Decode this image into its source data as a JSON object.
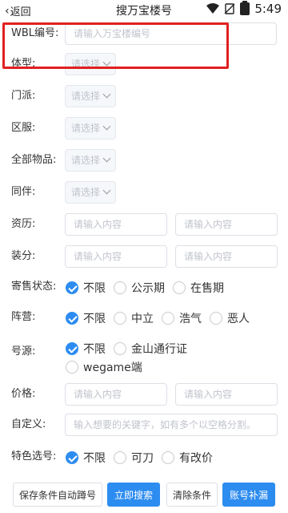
{
  "status": {
    "back_label": "返回",
    "title": "搜万宝楼号",
    "time": "5:49"
  },
  "form": {
    "wbl": {
      "label": "WBL编号:",
      "placeholder": "请输入万宝楼编号"
    },
    "body_type": {
      "label": "体型:",
      "value": "请选择"
    },
    "school": {
      "label": "门派:",
      "value": "请选择"
    },
    "server": {
      "label": "区服:",
      "value": "请选择"
    },
    "items": {
      "label": "全部物品:",
      "value": "请选择"
    },
    "companion": {
      "label": "同伴:",
      "value": "请选择"
    },
    "qualification": {
      "label": "资历:",
      "min_placeholder": "请输入内容",
      "max_placeholder": "请输入内容"
    },
    "gear_score": {
      "label": "装分:",
      "min_placeholder": "请输入内容",
      "max_placeholder": "请输入内容"
    },
    "sale_status": {
      "label": "寄售状态:",
      "options": [
        {
          "label": "不限",
          "checked": true
        },
        {
          "label": "公示期",
          "checked": false
        },
        {
          "label": "在售期",
          "checked": false
        }
      ]
    },
    "camp": {
      "label": "阵营:",
      "options": [
        {
          "label": "不限",
          "checked": true
        },
        {
          "label": "中立",
          "checked": false
        },
        {
          "label": "浩气",
          "checked": false
        },
        {
          "label": "恶人",
          "checked": false
        }
      ]
    },
    "account_source": {
      "label": "号源:",
      "options": [
        {
          "label": "不限",
          "checked": true
        },
        {
          "label": "金山通行证",
          "checked": false
        },
        {
          "label": "wegame端",
          "checked": false
        }
      ]
    },
    "price": {
      "label": "价格:",
      "min_placeholder": "请输入内容",
      "max_placeholder": "请输入内容"
    },
    "custom": {
      "label": "自定义:",
      "placeholder": "输入想要的关键字，如有多个以空格分割。"
    },
    "special": {
      "label": "特色选号:",
      "options": [
        {
          "label": "不限",
          "checked": true
        },
        {
          "label": "可刀",
          "checked": false
        },
        {
          "label": "有改价",
          "checked": false
        }
      ]
    }
  },
  "buttons": {
    "save": "保存条件自动蹲号",
    "search": "立即搜索",
    "clear": "清除条件",
    "supplement": "账号补漏"
  },
  "colors": {
    "accent": "#2d8cf0",
    "highlight": "#e02020"
  }
}
